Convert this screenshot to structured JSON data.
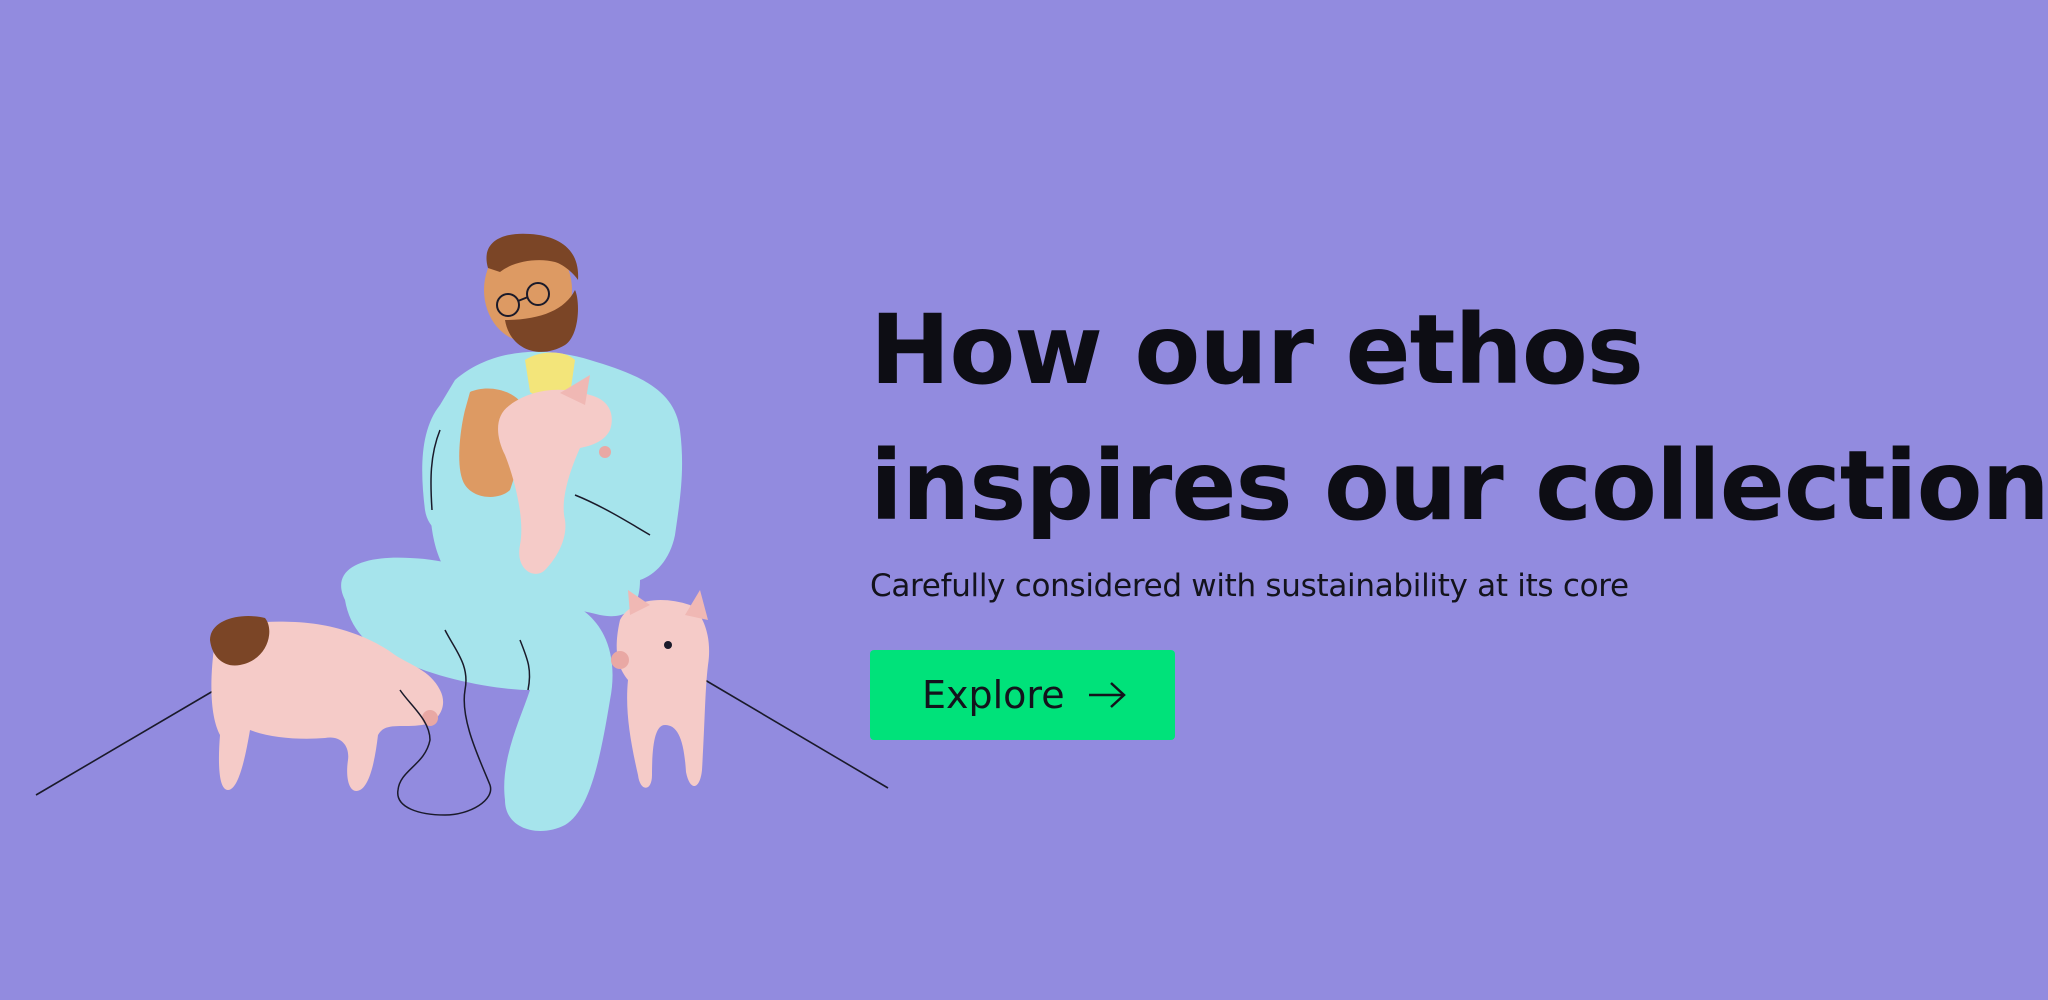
{
  "hero": {
    "headline_line1": "How our ethos",
    "headline_line2": "inspires our collection",
    "subtitle": "Carefully considered with sustainability at its core",
    "cta_label": "Explore",
    "cta_icon": "arrow-right-icon",
    "illustration": "farmer-holding-piglet-illustration"
  },
  "colors": {
    "background": "#928bdf",
    "cta": "#00e27a",
    "text": "#0d0d14"
  }
}
